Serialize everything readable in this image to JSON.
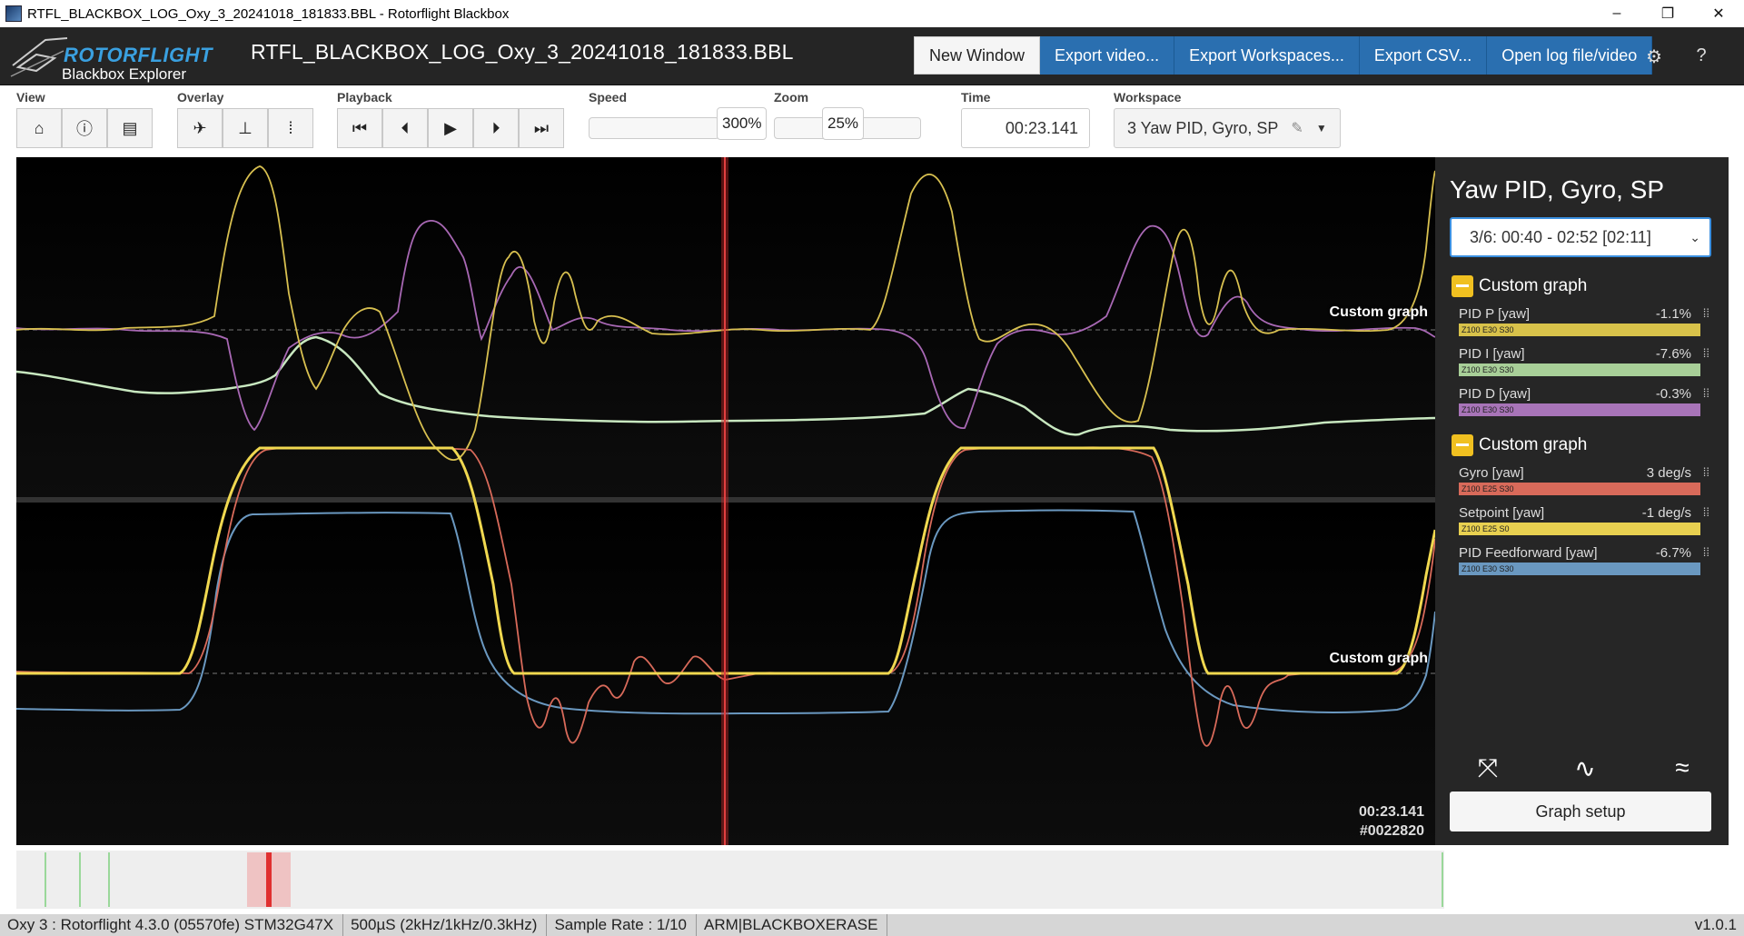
{
  "window": {
    "title": "RTFL_BLACKBOX_LOG_Oxy_3_20241018_181833.BBL - Rotorflight Blackbox",
    "controls": {
      "minimize": "–",
      "maximize": "❐",
      "close": "✕"
    }
  },
  "header": {
    "brand": "ROTORFLIGHT",
    "subtitle": "Blackbox Explorer",
    "filename": "RTFL_BLACKBOX_LOG_Oxy_3_20241018_181833.BBL",
    "buttons": [
      "New Window",
      "Export video...",
      "Export Workspaces...",
      "Export CSV...",
      "Open log file/video"
    ],
    "icons": [
      "gear-icon",
      "help-icon"
    ]
  },
  "toolbar": {
    "view_label": "View",
    "overlay_label": "Overlay",
    "playback_label": "Playback",
    "speed_label": "Speed",
    "speed_value": "300%",
    "zoom_label": "Zoom",
    "zoom_value": "25%",
    "time_label": "Time",
    "time_value": "00:23.141",
    "workspace_label": "Workspace",
    "workspace_value": "3 Yaw PID, Gyro, SP"
  },
  "graph": {
    "label_top": "Custom graph",
    "label_bottom": "Custom graph",
    "timestamp": "00:23.141",
    "frame": "#0022820"
  },
  "panel": {
    "title": "Yaw PID, Gyro, SP",
    "selector": "3/6: 00:40 - 02:52 [02:11]",
    "groups": [
      {
        "title": "Custom graph",
        "fields": [
          {
            "name": "PID P [yaw]",
            "value": "-1.1%",
            "tag": "Z100 E30 S30",
            "color": "#d8c24a"
          },
          {
            "name": "PID I [yaw]",
            "value": "-7.6%",
            "tag": "Z100 E30 S30",
            "color": "#a8cf98"
          },
          {
            "name": "PID D [yaw]",
            "value": "-0.3%",
            "tag": "Z100 E30 S30",
            "color": "#a874b8"
          }
        ]
      },
      {
        "title": "Custom graph",
        "fields": [
          {
            "name": "Gyro [yaw]",
            "value": "3 deg/s",
            "tag": "Z100 E25 S30",
            "color": "#d86a5a"
          },
          {
            "name": "Setpoint [yaw]",
            "value": "-1 deg/s",
            "tag": "Z100 E25 S0",
            "color": "#e8d050"
          },
          {
            "name": "PID Feedforward [yaw]",
            "value": "-6.7%",
            "tag": "Z100 E30 S30",
            "color": "#6a98c0"
          }
        ]
      }
    ],
    "graph_setup": "Graph setup"
  },
  "status": {
    "segments": [
      "Oxy 3 : Rotorflight 4.3.0 (05570fe) STM32G47X",
      "500µS (2kHz/1kHz/0.3kHz)",
      "Sample Rate : 1/10",
      "ARM|BLACKBOXERASE"
    ],
    "version": "v1.0.1"
  }
}
